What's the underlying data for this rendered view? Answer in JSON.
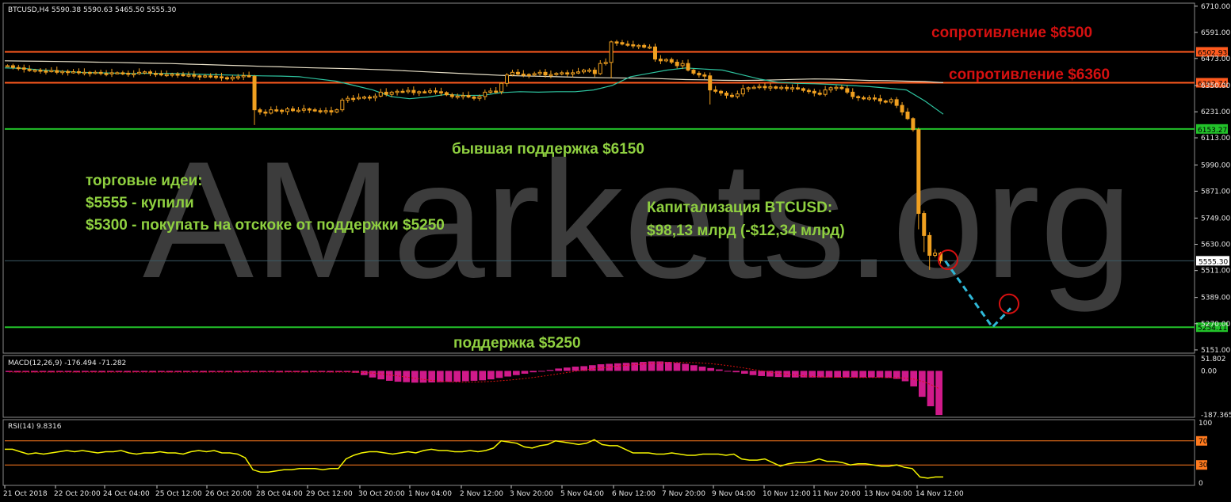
{
  "chart_data": {
    "type": "candlestick",
    "symbol_header": "BTCUSD,H4  5590.38 5590.63 5465.50 5555.30",
    "watermark": "AMarkets.org",
    "price_axis_labels": [
      "6710.00",
      "6591.00",
      "6473.00",
      "6350.00",
      "6231.00",
      "6113.00",
      "5990.00",
      "5871.00",
      "5749.00",
      "5630.00",
      "5511.00",
      "5389.00",
      "5270.00",
      "5151.00"
    ],
    "price_range": [
      5140,
      6720
    ],
    "levels": [
      {
        "label": "6502.93",
        "value": 6502.93,
        "kind": "resistance",
        "color": "#ff5a1e"
      },
      {
        "label": "6362.74",
        "value": 6362.74,
        "kind": "resistance",
        "color": "#ff5a1e"
      },
      {
        "label": "6153.27",
        "value": 6153.27,
        "kind": "support",
        "color": "#22c22a"
      },
      {
        "label": "5254.11",
        "value": 5254.11,
        "kind": "support",
        "color": "#22c22a"
      }
    ],
    "current_price_label": "5555.30",
    "current_price": 5555.3,
    "x_labels": [
      "21 Oct 2018",
      "22 Oct 20:00",
      "24 Oct 04:00",
      "25 Oct 12:00",
      "26 Oct 20:00",
      "28 Oct 04:00",
      "29 Oct 12:00",
      "30 Oct 20:00",
      "1 Nov 04:00",
      "2 Nov 12:00",
      "3 Nov 20:00",
      "5 Nov 04:00",
      "6 Nov 12:00",
      "7 Nov 20:00",
      "9 Nov 04:00",
      "10 Nov 12:00",
      "11 Nov 20:00",
      "13 Nov 04:00",
      "14 Nov 12:00"
    ],
    "close_prices": [
      6440,
      6432,
      6430,
      6424,
      6418,
      6420,
      6416,
      6415,
      6418,
      6410,
      6414,
      6410,
      6413,
      6408,
      6410,
      6406,
      6410,
      6405,
      6404,
      6408,
      6408,
      6406,
      6402,
      6404,
      6410,
      6412,
      6405,
      6404,
      6398,
      6400,
      6402,
      6400,
      6396,
      6398,
      6394,
      6390,
      6394,
      6392,
      6390,
      6386,
      6380,
      6388,
      6390,
      6395,
      6392,
      6240,
      6230,
      6225,
      6240,
      6238,
      6232,
      6244,
      6236,
      6238,
      6244,
      6240,
      6236,
      6232,
      6236,
      6230,
      6240,
      6284,
      6292,
      6290,
      6296,
      6298,
      6294,
      6302,
      6320,
      6310,
      6320,
      6324,
      6322,
      6328,
      6318,
      6322,
      6320,
      6326,
      6322,
      6318,
      6308,
      6300,
      6302,
      6305,
      6298,
      6292,
      6300,
      6320,
      6325,
      6322,
      6360,
      6398,
      6410,
      6402,
      6400,
      6398,
      6404,
      6410,
      6398,
      6400,
      6405,
      6408,
      6402,
      6408,
      6412,
      6420,
      6420,
      6404,
      6450,
      6455,
      6548,
      6545,
      6538,
      6535,
      6530,
      6532,
      6524,
      6525,
      6470,
      6462,
      6468,
      6456,
      6440,
      6450,
      6420,
      6406,
      6398,
      6394,
      6330,
      6324,
      6316,
      6306,
      6300,
      6312,
      6336,
      6340,
      6342,
      6346,
      6340,
      6344,
      6338,
      6342,
      6336,
      6340,
      6336,
      6328,
      6324,
      6316,
      6310,
      6330,
      6340,
      6342,
      6336,
      6320,
      6300,
      6295,
      6290,
      6294,
      6290,
      6280,
      6275,
      6286,
      6260,
      6230,
      6200,
      6150,
      5770,
      5670,
      5580,
      5590,
      5555
    ],
    "ma_series": [
      {
        "name": "",
        "color": "#e8e0c8",
        "values": [
          6462,
          6461,
          6460,
          6459,
          6458,
          6456,
          6455,
          6453,
          6451,
          6450,
          6447,
          6445,
          6442,
          6440,
          6437,
          6435,
          6432,
          6430,
          6428,
          6426,
          6423,
          6420,
          6416,
          6412,
          6408,
          6404,
          6400,
          6396,
          6394,
          6392,
          6390,
          6388,
          6386,
          6385,
          6384,
          6383,
          6380,
          6377,
          6376,
          6374,
          6373,
          6374,
          6376,
          6378,
          6380,
          6379,
          6376,
          6373,
          6372,
          6370,
          6368,
          6363
        ]
      },
      {
        "name": "",
        "color": "#2ec4a0",
        "values": [
          6430,
          6428,
          6420,
          6415,
          6410,
          6408,
          6406,
          6405,
          6405,
          6405,
          6403,
          6400,
          6398,
          6396,
          6394,
          6393,
          6390,
          6380,
          6370,
          6350,
          6330,
          6300,
          6290,
          6298,
          6310,
          6305,
          6306,
          6318,
          6322,
          6320,
          6322,
          6322,
          6330,
          6350,
          6390,
          6405,
          6420,
          6430,
          6425,
          6420,
          6400,
          6380,
          6365,
          6360,
          6358,
          6355,
          6350,
          6345,
          6338,
          6330,
          6280,
          6220
        ]
      }
    ],
    "projection": {
      "points": [
        [
          5555,
          0
        ],
        [
          5254,
          1
        ],
        [
          5340,
          2
        ]
      ],
      "color": "#2fb8d8"
    },
    "annotations": [
      {
        "text": "сопротивление $6500",
        "color": "#d61010"
      },
      {
        "text": "сопротивление $6360",
        "color": "#d61010"
      },
      {
        "text": "бывшая поддержка $6150",
        "color": "#8fd040"
      },
      {
        "text": "торговые идеи:",
        "color": "#8fd040"
      },
      {
        "text": "$5555 - купили",
        "color": "#8fd040"
      },
      {
        "text": "$5300 - покупать на отскоке от поддержки $5250",
        "color": "#8fd040"
      },
      {
        "text": "Капитализация BTCUSD:",
        "color": "#8fd040"
      },
      {
        "text": "$98,13 млрд (-$12,34 млрд)",
        "color": "#8fd040"
      },
      {
        "text": "поддержка $5250",
        "color": "#8fd040"
      }
    ],
    "macd": {
      "label": "MACD(12,26,9) -176.494 -71.282",
      "axis_labels": [
        "51.802",
        "0.00",
        "-187.365"
      ],
      "range": [
        -190,
        55
      ],
      "histogram": [
        -5,
        -6,
        -5,
        -6,
        -5,
        -6,
        -5,
        -5,
        -6,
        -5,
        -5,
        -6,
        -5,
        -5,
        -6,
        -5,
        -5,
        -6,
        -5,
        -6,
        -5,
        -5,
        -5,
        -6,
        -5,
        -5,
        -5,
        -6,
        -5,
        -5,
        -5,
        -5,
        -6,
        -5,
        -5,
        -6,
        -5,
        -5,
        -6,
        -5,
        -5,
        -8,
        -18,
        -28,
        -36,
        -42,
        -46,
        -48,
        -50,
        -50,
        -49,
        -48,
        -47,
        -46,
        -44,
        -42,
        -40,
        -36,
        -30,
        -24,
        -18,
        -12,
        -6,
        -2,
        4,
        10,
        14,
        18,
        20,
        24,
        28,
        30,
        32,
        34,
        36,
        38,
        40,
        40,
        38,
        34,
        30,
        24,
        18,
        12,
        6,
        0,
        -6,
        -12,
        -18,
        -22,
        -24,
        -26,
        -27,
        -28,
        -28,
        -28,
        -28,
        -28,
        -28,
        -28,
        -28,
        -28,
        -28,
        -28,
        -30,
        -34,
        -44,
        -66,
        -110,
        -150,
        -187
      ],
      "signal_color": "#d61010",
      "hist_color": "#d01a8a"
    },
    "rsi": {
      "label": "RSI(14) 9.8316",
      "axis_labels": [
        "100",
        "70",
        "30",
        "0"
      ],
      "levels": [
        70,
        30
      ],
      "values": [
        56,
        56,
        52,
        48,
        50,
        48,
        50,
        52,
        54,
        52,
        54,
        52,
        50,
        52,
        52,
        54,
        50,
        48,
        50,
        50,
        52,
        50,
        50,
        48,
        52,
        54,
        52,
        54,
        50,
        50,
        48,
        42,
        22,
        18,
        18,
        20,
        22,
        22,
        24,
        24,
        24,
        22,
        24,
        24,
        40,
        46,
        50,
        52,
        52,
        50,
        48,
        50,
        52,
        50,
        54,
        56,
        54,
        54,
        52,
        52,
        54,
        52,
        54,
        58,
        70,
        68,
        66,
        60,
        58,
        62,
        64,
        70,
        68,
        66,
        64,
        66,
        72,
        64,
        62,
        62,
        56,
        50,
        50,
        50,
        48,
        48,
        50,
        48,
        46,
        46,
        48,
        48,
        48,
        46,
        48,
        40,
        38,
        38,
        40,
        34,
        28,
        32,
        34,
        34,
        36,
        40,
        36,
        36,
        34,
        30,
        32,
        32,
        30,
        28,
        28,
        30,
        26,
        24,
        10,
        8,
        10,
        10
      ],
      "color": "#f4f400"
    }
  }
}
